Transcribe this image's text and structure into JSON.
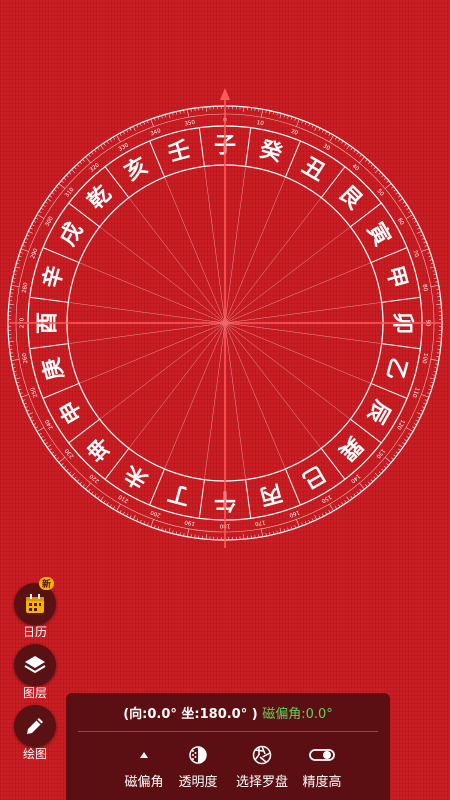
{
  "compass": {
    "mountains": [
      "子",
      "癸",
      "丑",
      "艮",
      "寅",
      "甲",
      "卯",
      "乙",
      "辰",
      "巽",
      "巳",
      "丙",
      "午",
      "丁",
      "未",
      "坤",
      "申",
      "庚",
      "酉",
      "辛",
      "戌",
      "乾",
      "亥",
      "壬"
    ],
    "degree_labels": [
      "0",
      "10",
      "20",
      "30",
      "40",
      "50",
      "60",
      "70",
      "80",
      "90",
      "100",
      "110",
      "120",
      "130",
      "140",
      "150",
      "160",
      "170",
      "180",
      "190",
      "200",
      "210",
      "220",
      "230",
      "240",
      "250",
      "260",
      "270",
      "280",
      "290",
      "300",
      "310",
      "320",
      "330",
      "340",
      "350"
    ]
  },
  "sidebar": {
    "calendar": {
      "label": "日历",
      "badge": "新"
    },
    "layers": {
      "label": "图层"
    },
    "draw": {
      "label": "绘图"
    }
  },
  "panel": {
    "direction_text": "(向:0.0°  坐:180.0° )",
    "declination_text": "磁偏角:0.0°",
    "tools": {
      "declination": "磁偏角",
      "transparency": "透明度",
      "select_compass": "选择罗盘",
      "precision": "精度高"
    }
  },
  "colors": {
    "background": "#c8161d",
    "panel": "#5c0f12",
    "accent_green": "#5fd35a",
    "axis_line": "#ff5b5b"
  }
}
